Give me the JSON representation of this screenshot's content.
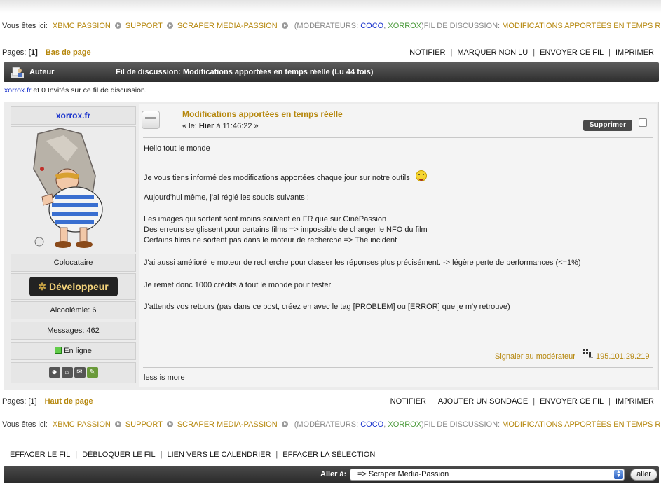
{
  "breadcrumb": {
    "prefix": "Vous êtes ici:",
    "items": [
      "XBMC PASSION",
      "SUPPORT",
      "SCRAPER MEDIA-PASSION"
    ],
    "moderators_label": "(MODÉRATEURS:",
    "moderator_1": "COCO",
    "comma": ",",
    "moderator_2": "XORROX",
    "moderators_end": ")",
    "thread_prefix": "FIL DE DISCUSSION:",
    "thread_title": "MODIFICATIONS APPORTÉES EN TEMPS RÉELLE"
  },
  "top_pagination": {
    "label": "Pages:",
    "current": "[1]",
    "jump_link": "Bas de page",
    "actions": [
      "NOTIFIER",
      "MARQUER NON LU",
      "ENVOYER CE FIL",
      "IMPRIMER"
    ]
  },
  "header": {
    "author_label": "Auteur",
    "thread_heading": "Fil de discussion: Modifications apportées en temps réelle  (Lu 44 fois)"
  },
  "viewers": {
    "user": "xorrox.fr",
    "text": " et 0 Invités sur ce fil de discussion."
  },
  "poster": {
    "username": "xorrox.fr",
    "rank": "Colocataire",
    "badge": "Développeur",
    "karma": "Alcoolémie: 6",
    "messages": "Messages: 462",
    "status": "En ligne"
  },
  "post": {
    "title": "Modifications apportées en temps réelle",
    "date_prefix": "« le:",
    "date_day": "Hier",
    "date_time": "à 11:46:22 »",
    "delete_label": "Supprimer",
    "body": {
      "line1": "Hello tout le monde",
      "line2": "Je vous tiens informé des modifications apportées chaque jour sur notre outils",
      "line3": "Aujourd'hui même, j'ai réglé les soucis suivants :",
      "line4": "Les images qui sortent sont moins souvent en FR que sur CinéPassion",
      "line5": "Des erreurs se glissent pour certains films => impossible de charger le NFO du film",
      "line6": "Certains films ne sortent pas dans le moteur de recherche => The incident",
      "line7": "J'ai aussi amélioré le moteur de recherche pour classer les réponses plus précisément. -> légère perte de performances (<=1%)",
      "line8": "Je remet donc 1000 crédits à tout le monde pour tester",
      "line9": "J'attends vos retours (pas dans ce post, créez en avec le tag [PROBLEM] ou [ERROR] que je m'y retrouve)"
    },
    "report_link": "Signaler au modérateur",
    "ip": "195.101.29.219",
    "signature": "less is more"
  },
  "bottom_pagination": {
    "label": "Pages:",
    "current": "[1]",
    "jump_link": "Haut de page",
    "actions": [
      "NOTIFIER",
      "AJOUTER UN SONDAGE",
      "ENVOYER CE FIL",
      "IMPRIMER"
    ]
  },
  "moderation": {
    "actions": [
      "EFFACER LE FIL",
      "DÉBLOQUER LE FIL",
      "LIEN VERS LE CALENDRIER",
      "EFFACER LA SÉLECTION"
    ]
  },
  "jump": {
    "label": "Aller à:",
    "selected": "=> Scraper Media-Passion",
    "go": "aller"
  }
}
